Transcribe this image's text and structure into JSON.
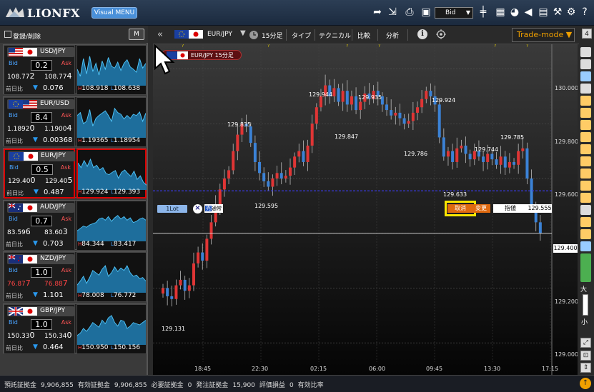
{
  "app": {
    "logo_text": "LIONFX",
    "visual_menu_label": "Visual MENU",
    "rate_type": "Bid"
  },
  "left_panel": {
    "register_label": "登録/削除",
    "m_label": "M",
    "change_label": "前日比",
    "pairs": [
      {
        "name": "USD/JPY",
        "spread": "0.2",
        "bid": "108.77",
        "bid_big": "2",
        "ask": "108.77",
        "ask_big": "4",
        "change": "0.076",
        "high": "108.918",
        "low": "108.638",
        "selected": false,
        "color": "white"
      },
      {
        "name": "EUR/USD",
        "spread": "8.4",
        "bid": "1.1892",
        "bid_big": "0",
        "ask": "1.1900",
        "ask_big": "4",
        "change": "0.00368",
        "high": "1.19365",
        "low": "1.18954",
        "selected": false,
        "color": "white"
      },
      {
        "name": "EUR/JPY",
        "spread": "0.5",
        "bid": "129.40",
        "bid_big": "0",
        "ask": "129.40",
        "ask_big": "5",
        "change": "0.487",
        "high": "129.924",
        "low": "129.393",
        "selected": true,
        "color": "white"
      },
      {
        "name": "AUD/JPY",
        "spread": "0.7",
        "bid": "83.59",
        "bid_big": "6",
        "ask": "83.60",
        "ask_big": "3",
        "change": "0.703",
        "high": "84.344",
        "low": "83.417",
        "selected": false,
        "color": "white"
      },
      {
        "name": "NZD/JPY",
        "spread": "1.0",
        "bid": "76.87",
        "bid_big": "7",
        "ask": "76.88",
        "ask_big": "7",
        "change": "1.101",
        "high": "78.008",
        "low": "76.772",
        "selected": false,
        "color": "red"
      },
      {
        "name": "GBP/JPY",
        "spread": "1.0",
        "bid": "150.33",
        "bid_big": "0",
        "ask": "150.34",
        "ask_big": "0",
        "change": "0.464",
        "high": "150.950",
        "low": "150.156",
        "selected": false,
        "color": "white"
      }
    ]
  },
  "chart_toolbar": {
    "pair": "EUR/JPY",
    "timeframe": "15分足",
    "type_label": "タイプ",
    "technical_label": "テクニカル",
    "compare_label": "比較",
    "analysis_label": "分析",
    "trade_mode_label": "Trade-mode ▼",
    "page_number": "4"
  },
  "chart": {
    "tag": "EUR/JPY 15分足",
    "lot_label": "1Lot",
    "sell_label": "売",
    "sell_type": "通常",
    "order_price": "129.595",
    "cancel_label": "取消",
    "change_label": "変更",
    "limit_label": "指値",
    "order_rate": "129.555",
    "current_price": "129.400",
    "y_labels": [
      "130.000",
      "129.800",
      "129.600",
      "129.200",
      "129.000"
    ],
    "x_labels": [
      "18:45",
      "22:30",
      "02:15",
      "06:00",
      "09:45",
      "13:30",
      "17:15"
    ],
    "annotations": [
      "129.835",
      "129.944",
      "129.935",
      "129.924",
      "129.847",
      "129.786",
      "129.785",
      "129.744",
      "129.633",
      "129.131"
    ],
    "zoom_large": "大",
    "zoom_small": "小"
  },
  "status_bar": {
    "items": [
      {
        "label": "預託証拠金",
        "value": "9,906,855"
      },
      {
        "label": "有効証拠金",
        "value": "9,906,855"
      },
      {
        "label": "必要証拠金",
        "value": "0"
      },
      {
        "label": "発注証拠金",
        "value": "15,900"
      },
      {
        "label": "評価損益",
        "value": "0"
      },
      {
        "label": "有効比率",
        "value": ""
      }
    ]
  },
  "chart_data": {
    "type": "candlestick",
    "title": "EUR/JPY 15分足",
    "x_labels": [
      "18:45",
      "22:30",
      "02:15",
      "06:00",
      "09:45",
      "13:30",
      "17:15"
    ],
    "ylim": [
      128.93,
      130.09
    ],
    "y_ticks": [
      129.0,
      129.2,
      129.4,
      129.6,
      129.8,
      130.0
    ],
    "candles_close": [
      129.2,
      129.17,
      129.16,
      129.21,
      129.23,
      129.19,
      129.21,
      129.29,
      129.33,
      129.3,
      129.38,
      129.44,
      129.5,
      129.56,
      129.6,
      129.63,
      129.7,
      129.76,
      129.8,
      129.79,
      129.73,
      129.66,
      129.62,
      129.59,
      129.57,
      129.6,
      129.62,
      129.6,
      129.61,
      129.64,
      129.68,
      129.7,
      129.66,
      129.72,
      129.8,
      129.86,
      129.9,
      129.94,
      129.9,
      129.93,
      129.88,
      129.92,
      129.87,
      129.9,
      129.85,
      129.88,
      129.91,
      129.89,
      129.92,
      129.9,
      129.87,
      129.85,
      129.83,
      129.84,
      129.82,
      129.8,
      129.81,
      129.84,
      129.86,
      129.89,
      129.92,
      129.9,
      129.87,
      129.75,
      129.68,
      129.7,
      129.66,
      129.71,
      129.72,
      129.69,
      129.67,
      129.7,
      129.68,
      129.66,
      129.69,
      129.67,
      129.65,
      129.68,
      129.64,
      129.66,
      129.65,
      129.7,
      129.71,
      129.6,
      129.5,
      129.44,
      129.4
    ],
    "reference_lines": {
      "order_price": 129.555,
      "current_price": 129.4
    }
  }
}
